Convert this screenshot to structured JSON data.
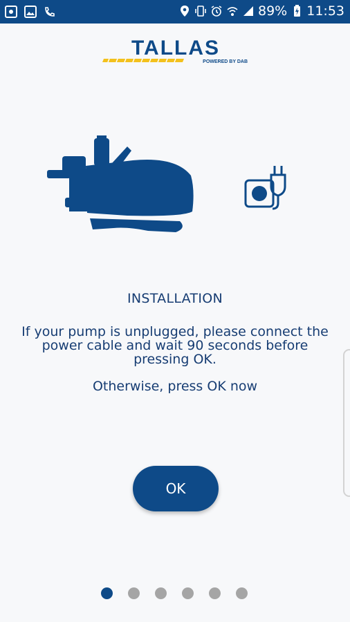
{
  "status_bar": {
    "battery": "89%",
    "time": "11:53",
    "background": "#0e4a88"
  },
  "logo": {
    "brand": "TALLAS",
    "tagline": "POWERED BY DAB"
  },
  "content": {
    "title": "INSTALLATION",
    "message": "If your pump is unplugged, please connect the power cable and wait 90 seconds before pressing OK.",
    "otherwise": "Otherwise, press OK now"
  },
  "ok_button": {
    "label": "OK"
  },
  "pagination": {
    "total": 6,
    "active_index": 0
  },
  "colors": {
    "accent": "#0e4a88",
    "text": "#173d73",
    "dot_inactive": "#a5a5a5",
    "logo_stripe": "#f3c11c"
  }
}
